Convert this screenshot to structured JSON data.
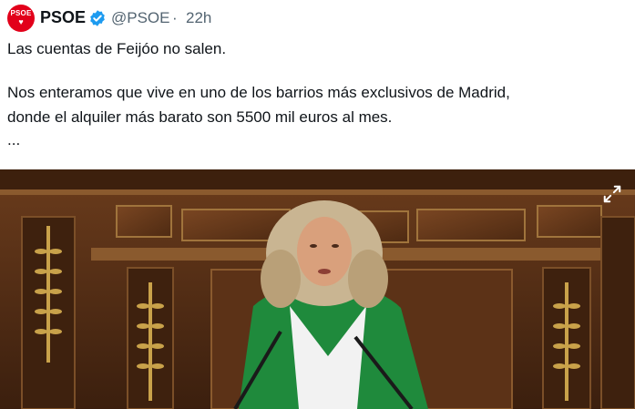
{
  "author": {
    "avatar_text": "PSOE",
    "name": "PSOE",
    "handle": "@PSOE",
    "separator": "·",
    "timestamp": "22h",
    "verified": true,
    "brand_color": "#e2001a"
  },
  "tweet": {
    "lines": [
      "Las cuentas de Feijóo no salen.",
      "Nos enteramos que vive en uno de los barrios más exclusivos de Madrid,",
      "donde el alquiler más barato son 5500 mil euros al mes.",
      "..."
    ]
  },
  "media": {
    "type": "video",
    "expand_icon": "expand-icon",
    "colors": {
      "wood": "#5a3218",
      "jacket": "#1f8a3c",
      "hair": "#c9b592"
    }
  }
}
